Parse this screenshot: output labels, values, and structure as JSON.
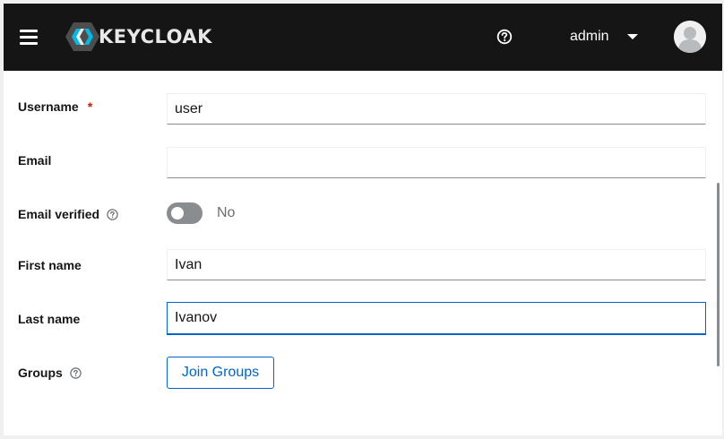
{
  "header": {
    "logo_text": "KEYCLOAK",
    "user_name": "admin"
  },
  "form": {
    "username": {
      "label": "Username",
      "required_mark": "*",
      "value": "user"
    },
    "email": {
      "label": "Email",
      "value": ""
    },
    "email_verified": {
      "label": "Email verified",
      "state": "No"
    },
    "first_name": {
      "label": "First name",
      "value": "Ivan"
    },
    "last_name": {
      "label": "Last name",
      "value": "Ivanov"
    },
    "groups": {
      "label": "Groups",
      "button_label": "Join Groups"
    }
  },
  "colors": {
    "masthead": "#151515",
    "accent": "#0066cc",
    "required": "#c9190b"
  }
}
